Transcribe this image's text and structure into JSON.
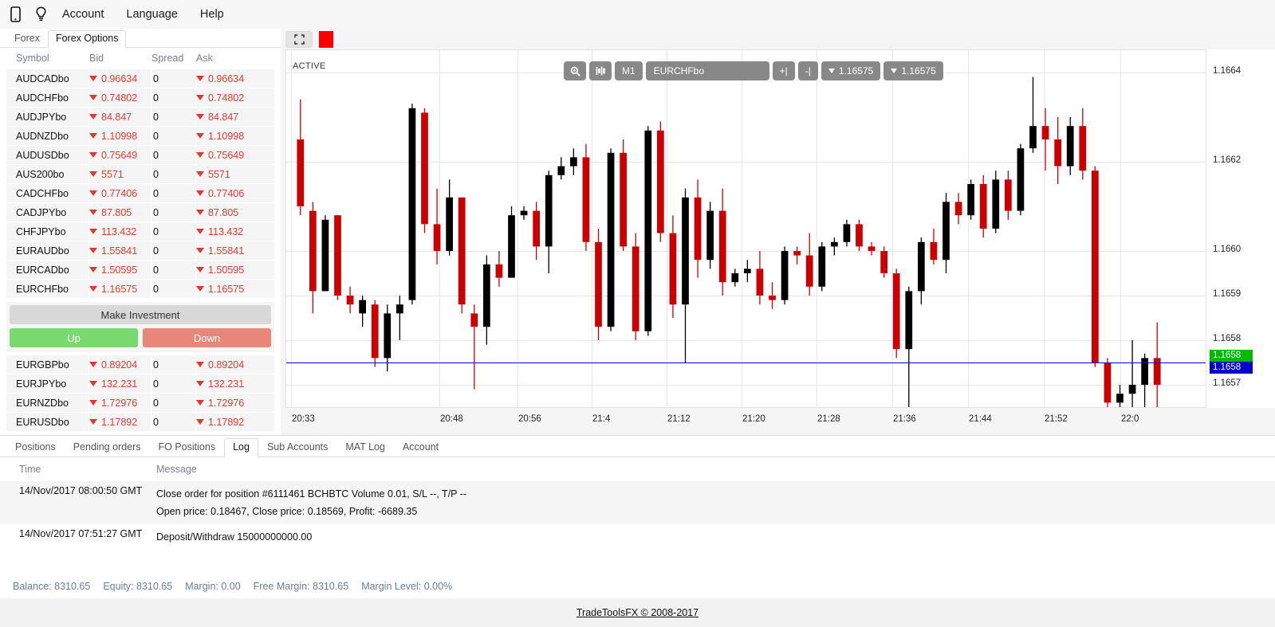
{
  "topbar": {
    "icons": [
      {
        "name": "mobile-icon",
        "glyph": "mobile"
      },
      {
        "name": "lightbulb-icon",
        "glyph": "bulb"
      }
    ],
    "menu": [
      "Account",
      "Language",
      "Help"
    ]
  },
  "left_panel": {
    "tabs": [
      {
        "label": "Forex",
        "active": false
      },
      {
        "label": "Forex Options",
        "active": true
      }
    ],
    "columns": [
      "Symbol",
      "Bid",
      "Spread",
      "Ask"
    ],
    "rows_top": [
      {
        "symbol": "AUDCADbo",
        "bid": "0.96634",
        "spread": "0",
        "ask": "0.96634",
        "dir": "down"
      },
      {
        "symbol": "AUDCHFbo",
        "bid": "0.74802",
        "spread": "0",
        "ask": "0.74802",
        "dir": "down"
      },
      {
        "symbol": "AUDJPYbo",
        "bid": "84.847",
        "spread": "0",
        "ask": "84.847",
        "dir": "down"
      },
      {
        "symbol": "AUDNZDbo",
        "bid": "1.10998",
        "spread": "0",
        "ask": "1.10998",
        "dir": "down"
      },
      {
        "symbol": "AUDUSDbo",
        "bid": "0.75649",
        "spread": "0",
        "ask": "0.75649",
        "dir": "down"
      },
      {
        "symbol": "AUS200bo",
        "bid": "5571",
        "spread": "0",
        "ask": "5571",
        "dir": "down"
      },
      {
        "symbol": "CADCHFbo",
        "bid": "0.77406",
        "spread": "0",
        "ask": "0.77406",
        "dir": "down"
      },
      {
        "symbol": "CADJPYbo",
        "bid": "87.805",
        "spread": "0",
        "ask": "87.805",
        "dir": "down"
      },
      {
        "symbol": "CHFJPYbo",
        "bid": "113.432",
        "spread": "0",
        "ask": "113.432",
        "dir": "down"
      },
      {
        "symbol": "EURAUDbo",
        "bid": "1.55841",
        "spread": "0",
        "ask": "1.55841",
        "dir": "down"
      },
      {
        "symbol": "EURCADbo",
        "bid": "1.50595",
        "spread": "0",
        "ask": "1.50595",
        "dir": "down"
      },
      {
        "symbol": "EURCHFbo",
        "bid": "1.16575",
        "spread": "0",
        "ask": "1.16575",
        "dir": "down"
      }
    ],
    "invest_label": "Make Investment",
    "up_label": "Up",
    "down_label": "Down",
    "rows_bottom": [
      {
        "symbol": "EURGBPbo",
        "bid": "0.89204",
        "spread": "0",
        "ask": "0.89204",
        "dir": "down"
      },
      {
        "symbol": "EURJPYbo",
        "bid": "132.231",
        "spread": "0",
        "ask": "132.231",
        "dir": "down"
      },
      {
        "symbol": "EURNZDbo",
        "bid": "1.72976",
        "spread": "0",
        "ask": "1.72976",
        "dir": "down"
      },
      {
        "symbol": "EURUSDbo",
        "bid": "1.17892",
        "spread": "0",
        "ask": "1.17892",
        "dir": "down"
      }
    ]
  },
  "chart_toolbar": {
    "expand_icon": "fullscreen-icon",
    "color_swatch": "#ff0000",
    "buttons": [
      {
        "name": "zoom-icon",
        "label": "",
        "icon": "magnifier"
      },
      {
        "name": "indicator-icon",
        "label": "",
        "icon": "bars"
      },
      {
        "name": "timeframe",
        "label": "M1"
      },
      {
        "name": "symbol-select",
        "label": "EURCHFbo"
      },
      {
        "name": "add-right",
        "label": "+|"
      },
      {
        "name": "remove-right",
        "label": "-|"
      },
      {
        "name": "bid-price",
        "label": "1.16575",
        "arrow": "down"
      },
      {
        "name": "ask-price",
        "label": "1.16575",
        "arrow": "down"
      }
    ]
  },
  "chart_data": {
    "type": "candlestick",
    "title": "EURCHFbo",
    "status_label": "ACTIVE",
    "timeframe": "M1",
    "xlabel": "",
    "ylabel": "",
    "ylim": [
      1.16565,
      1.16645
    ],
    "grid": true,
    "y_ticks": [
      "1.1664",
      "1.1662",
      "1.1660",
      "1.1659",
      "1.1658",
      "1.1657"
    ],
    "y_tick_values": [
      1.1664,
      1.1662,
      1.166,
      1.1659,
      1.1658,
      1.1657
    ],
    "x_ticks": [
      "20:33",
      "20:48",
      "20:56",
      "21:4",
      "21:12",
      "21:20",
      "21:28",
      "21:36",
      "21:44",
      "21:52",
      "22:0"
    ],
    "bid_line": 1.16575,
    "bid_badge": "1.1658",
    "ask_badge": "1.1658",
    "up_color": "#000000",
    "down_color": "#cc0000",
    "candles": [
      {
        "o": 1.16625,
        "h": 1.16634,
        "l": 1.16608,
        "c": 1.1661
      },
      {
        "o": 1.16609,
        "h": 1.16611,
        "l": 1.16586,
        "c": 1.16591
      },
      {
        "o": 1.16591,
        "h": 1.16608,
        "l": 1.16596,
        "c": 1.16607
      },
      {
        "o": 1.16608,
        "h": 1.16608,
        "l": 1.16589,
        "c": 1.1659
      },
      {
        "o": 1.1659,
        "h": 1.16592,
        "l": 1.16586,
        "c": 1.16588
      },
      {
        "o": 1.16586,
        "h": 1.1659,
        "l": 1.16583,
        "c": 1.16589
      },
      {
        "o": 1.16588,
        "h": 1.16589,
        "l": 1.16574,
        "c": 1.16576
      },
      {
        "o": 1.16576,
        "h": 1.16588,
        "l": 1.16573,
        "c": 1.16586
      },
      {
        "o": 1.16586,
        "h": 1.1659,
        "l": 1.1658,
        "c": 1.16588
      },
      {
        "o": 1.16589,
        "h": 1.16633,
        "l": 1.16588,
        "c": 1.16632
      },
      {
        "o": 1.16631,
        "h": 1.16632,
        "l": 1.16604,
        "c": 1.16606
      },
      {
        "o": 1.16606,
        "h": 1.16614,
        "l": 1.16597,
        "c": 1.166
      },
      {
        "o": 1.166,
        "h": 1.16616,
        "l": 1.16599,
        "c": 1.16612
      },
      {
        "o": 1.16612,
        "h": 1.16612,
        "l": 1.16586,
        "c": 1.16588
      },
      {
        "o": 1.16586,
        "h": 1.16588,
        "l": 1.16569,
        "c": 1.16583
      },
      {
        "o": 1.16583,
        "h": 1.16599,
        "l": 1.16579,
        "c": 1.16597
      },
      {
        "o": 1.16597,
        "h": 1.166,
        "l": 1.16592,
        "c": 1.16594
      },
      {
        "o": 1.16594,
        "h": 1.1661,
        "l": 1.16594,
        "c": 1.16608
      },
      {
        "o": 1.16608,
        "h": 1.1661,
        "l": 1.16607,
        "c": 1.16609
      },
      {
        "o": 1.16609,
        "h": 1.16611,
        "l": 1.16598,
        "c": 1.16601
      },
      {
        "o": 1.16601,
        "h": 1.16618,
        "l": 1.16595,
        "c": 1.16617
      },
      {
        "o": 1.16617,
        "h": 1.16621,
        "l": 1.16616,
        "c": 1.16619
      },
      {
        "o": 1.16619,
        "h": 1.16623,
        "l": 1.16617,
        "c": 1.16621
      },
      {
        "o": 1.16621,
        "h": 1.16624,
        "l": 1.166,
        "c": 1.16602
      },
      {
        "o": 1.16602,
        "h": 1.16605,
        "l": 1.1658,
        "c": 1.16583
      },
      {
        "o": 1.16583,
        "h": 1.16623,
        "l": 1.16582,
        "c": 1.16622
      },
      {
        "o": 1.16622,
        "h": 1.16625,
        "l": 1.166,
        "c": 1.16601
      },
      {
        "o": 1.16601,
        "h": 1.16604,
        "l": 1.1658,
        "c": 1.16582
      },
      {
        "o": 1.16582,
        "h": 1.16628,
        "l": 1.16581,
        "c": 1.16627
      },
      {
        "o": 1.16627,
        "h": 1.16629,
        "l": 1.16602,
        "c": 1.16604
      },
      {
        "o": 1.16604,
        "h": 1.16608,
        "l": 1.16585,
        "c": 1.16588
      },
      {
        "o": 1.16588,
        "h": 1.16614,
        "l": 1.16575,
        "c": 1.16612
      },
      {
        "o": 1.16612,
        "h": 1.16616,
        "l": 1.16594,
        "c": 1.16598
      },
      {
        "o": 1.16598,
        "h": 1.16611,
        "l": 1.16596,
        "c": 1.16609
      },
      {
        "o": 1.16609,
        "h": 1.16614,
        "l": 1.1659,
        "c": 1.16593
      },
      {
        "o": 1.16593,
        "h": 1.16596,
        "l": 1.16592,
        "c": 1.16595
      },
      {
        "o": 1.16595,
        "h": 1.16598,
        "l": 1.16593,
        "c": 1.16596
      },
      {
        "o": 1.16596,
        "h": 1.166,
        "l": 1.16588,
        "c": 1.1659
      },
      {
        "o": 1.1659,
        "h": 1.16593,
        "l": 1.16587,
        "c": 1.16589
      },
      {
        "o": 1.16589,
        "h": 1.16601,
        "l": 1.16588,
        "c": 1.166
      },
      {
        "o": 1.166,
        "h": 1.16601,
        "l": 1.16597,
        "c": 1.16599
      },
      {
        "o": 1.16599,
        "h": 1.16604,
        "l": 1.1659,
        "c": 1.16592
      },
      {
        "o": 1.16592,
        "h": 1.16602,
        "l": 1.16591,
        "c": 1.16601
      },
      {
        "o": 1.16601,
        "h": 1.16603,
        "l": 1.16599,
        "c": 1.16602
      },
      {
        "o": 1.16602,
        "h": 1.16607,
        "l": 1.16601,
        "c": 1.16606
      },
      {
        "o": 1.16606,
        "h": 1.16607,
        "l": 1.166,
        "c": 1.16601
      },
      {
        "o": 1.16601,
        "h": 1.16602,
        "l": 1.16599,
        "c": 1.166
      },
      {
        "o": 1.166,
        "h": 1.16601,
        "l": 1.16594,
        "c": 1.16595
      },
      {
        "o": 1.16595,
        "h": 1.16596,
        "l": 1.16576,
        "c": 1.16578
      },
      {
        "o": 1.16578,
        "h": 1.16592,
        "l": 1.16565,
        "c": 1.16591
      },
      {
        "o": 1.16591,
        "h": 1.16603,
        "l": 1.16588,
        "c": 1.16602
      },
      {
        "o": 1.16602,
        "h": 1.16605,
        "l": 1.16597,
        "c": 1.16598
      },
      {
        "o": 1.16598,
        "h": 1.16613,
        "l": 1.16595,
        "c": 1.16611
      },
      {
        "o": 1.16611,
        "h": 1.16613,
        "l": 1.16606,
        "c": 1.16608
      },
      {
        "o": 1.16608,
        "h": 1.16616,
        "l": 1.16607,
        "c": 1.16615
      },
      {
        "o": 1.16615,
        "h": 1.16617,
        "l": 1.16603,
        "c": 1.16605
      },
      {
        "o": 1.16605,
        "h": 1.16618,
        "l": 1.16604,
        "c": 1.16616
      },
      {
        "o": 1.16616,
        "h": 1.16618,
        "l": 1.16607,
        "c": 1.16609
      },
      {
        "o": 1.16609,
        "h": 1.16624,
        "l": 1.16608,
        "c": 1.16623
      },
      {
        "o": 1.16623,
        "h": 1.16639,
        "l": 1.16622,
        "c": 1.16628
      },
      {
        "o": 1.16628,
        "h": 1.16632,
        "l": 1.16618,
        "c": 1.16625
      },
      {
        "o": 1.16625,
        "h": 1.1663,
        "l": 1.16615,
        "c": 1.16619
      },
      {
        "o": 1.16619,
        "h": 1.1663,
        "l": 1.16617,
        "c": 1.16628
      },
      {
        "o": 1.16628,
        "h": 1.16632,
        "l": 1.16616,
        "c": 1.16618
      },
      {
        "o": 1.16618,
        "h": 1.16619,
        "l": 1.16574,
        "c": 1.16575
      },
      {
        "o": 1.16575,
        "h": 1.16576,
        "l": 1.16565,
        "c": 1.16566
      },
      {
        "o": 1.16566,
        "h": 1.1657,
        "l": 1.16558,
        "c": 1.16568
      },
      {
        "o": 1.16568,
        "h": 1.1658,
        "l": 1.16557,
        "c": 1.1657
      },
      {
        "o": 1.1657,
        "h": 1.16577,
        "l": 1.16556,
        "c": 1.16576
      },
      {
        "o": 1.16576,
        "h": 1.16584,
        "l": 1.16555,
        "c": 1.1657
      }
    ]
  },
  "bottom_panel": {
    "tabs": [
      {
        "label": "Positions",
        "active": false
      },
      {
        "label": "Pending orders",
        "active": false
      },
      {
        "label": "FO Positions",
        "active": false
      },
      {
        "label": "Log",
        "active": true
      },
      {
        "label": "Sub Accounts",
        "active": false
      },
      {
        "label": "MAT Log",
        "active": false
      },
      {
        "label": "Account",
        "active": false
      }
    ],
    "columns": [
      "Time",
      "Message"
    ],
    "rows": [
      {
        "time": "14/Nov/2017 08:00:50 GMT",
        "lines": [
          "Close order for position #6111461 BCHBTC Volume 0.01, S/L --, T/P --",
          "Open price: 0.18467, Close price: 0.18569, Profit: -6689.35"
        ]
      },
      {
        "time": "14/Nov/2017 07:51:27 GMT",
        "lines": [
          "Deposit/Withdraw 15000000000.00"
        ]
      }
    ]
  },
  "status_bar": {
    "balance": "Balance: 8310.65",
    "equity": "Equity: 8310.65",
    "margin": "Margin: 0.00",
    "free_margin": "Free Margin: 8310.65",
    "margin_level": "Margin Level: 0.00%"
  },
  "footer": {
    "text": "TradeToolsFX © 2008-2017"
  }
}
